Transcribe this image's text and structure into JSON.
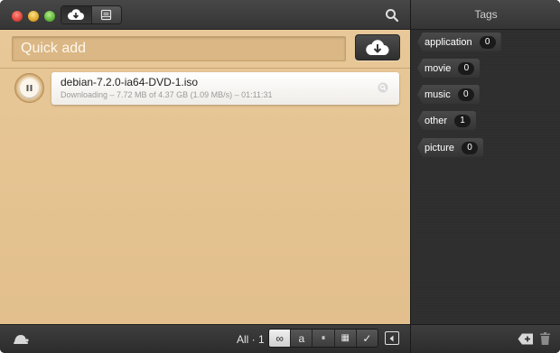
{
  "window": {
    "controls": [
      "close-button",
      "minimize-button",
      "zoom-button"
    ]
  },
  "toolbar": {
    "view_modes": [
      {
        "name": "downloads-view",
        "icon": "cloud-download-icon",
        "active": true
      },
      {
        "name": "history-view",
        "icon": "archive-icon",
        "active": false
      }
    ],
    "search_icon": "search-icon"
  },
  "quick_add": {
    "placeholder": "Quick add",
    "value": "",
    "button_icon": "cloud-download-icon"
  },
  "downloads": [
    {
      "name": "debian-7.2.0-ia64-DVD-1.iso",
      "status": "Downloading – 7.72 MB of 4.37 GB (1.09 MB/s) – 01:11:31",
      "state": "downloading",
      "pause_icon": "pause-icon",
      "info_icon": "magnifier-icon"
    }
  ],
  "bottombar": {
    "speed_icon": "turtle-icon",
    "filter_label": "All · 1",
    "filters": [
      {
        "name": "all",
        "label": "∞",
        "active": true
      },
      {
        "name": "active",
        "label": "a",
        "active": false
      },
      {
        "name": "paused",
        "label": "⏸",
        "active": false
      },
      {
        "name": "queued",
        "label": "▦",
        "active": false
      },
      {
        "name": "completed",
        "label": "✓",
        "active": false
      }
    ],
    "sidebar_toggle_icon": "sidebar-toggle-icon"
  },
  "tags_panel": {
    "title": "Tags",
    "tags": [
      {
        "label": "application",
        "count": "0"
      },
      {
        "label": "movie",
        "count": "0"
      },
      {
        "label": "music",
        "count": "0"
      },
      {
        "label": "other",
        "count": "1"
      },
      {
        "label": "picture",
        "count": "0"
      }
    ],
    "add_icon": "add-tag-icon",
    "trash_icon": "trash-icon"
  },
  "colors": {
    "wood": "#e3c28f",
    "dark_panel": "#2f2f2f",
    "toolbar": "#3d3d3d"
  }
}
